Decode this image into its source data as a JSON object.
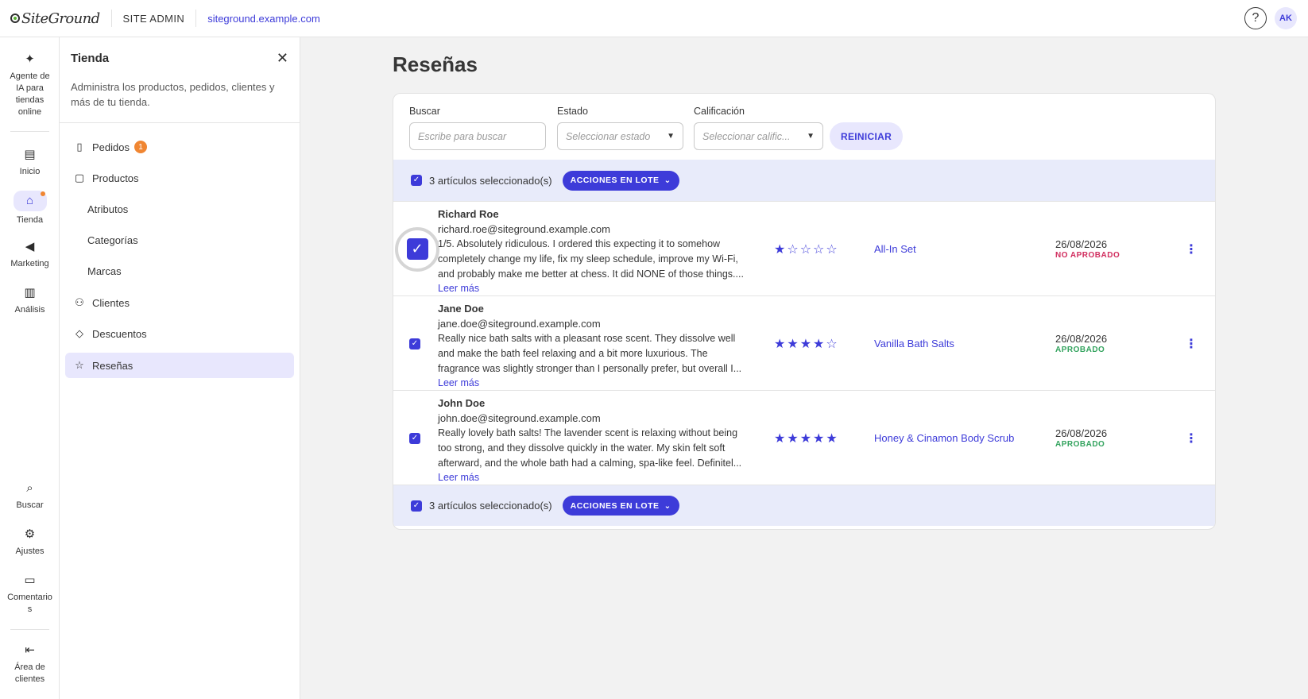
{
  "topbar": {
    "logo_text": "SiteGround",
    "section": "SITE ADMIN",
    "site_url": "siteground.example.com",
    "help_icon": "?",
    "avatar": "AK"
  },
  "rail": {
    "ai_agent": "Agente de IA para tiendas online",
    "home": "Inicio",
    "store": "Tienda",
    "marketing": "Marketing",
    "analytics": "Análisis",
    "search": "Buscar",
    "settings": "Ajustes",
    "feedback": "Comentarios",
    "client_area": "Área de clientes"
  },
  "panel": {
    "title": "Tienda",
    "description": "Administra los productos, pedidos, clientes y más de tu tienda.",
    "items": [
      {
        "label": "Pedidos",
        "badge": "1"
      },
      {
        "label": "Productos"
      },
      {
        "label": "Atributos"
      },
      {
        "label": "Categorías"
      },
      {
        "label": "Marcas"
      },
      {
        "label": "Clientes"
      },
      {
        "label": "Descuentos"
      },
      {
        "label": "Reseñas"
      }
    ]
  },
  "main": {
    "title": "Reseñas",
    "filters": {
      "search_label": "Buscar",
      "search_placeholder": "Escribe para buscar",
      "status_label": "Estado",
      "status_placeholder": "Seleccionar estado",
      "rating_label": "Calificación",
      "rating_placeholder": "Seleccionar calific...",
      "reset": "REINICIAR"
    },
    "bulk": {
      "selected_text": "3 artículos seleccionado(s)",
      "actions": "ACCIONES EN LOTE"
    },
    "reviews": [
      {
        "name": "Richard Roe",
        "email": "richard.roe@siteground.example.com",
        "text": "1/5. Absolutely ridiculous. I ordered this expecting it to somehow completely change my life, fix my sleep schedule, improve my Wi-Fi, and probably make me better at chess. It did NONE of those things....",
        "read_more": "Leer más",
        "rating": 1,
        "stars": "★☆☆☆☆",
        "product": "All-In Set",
        "date": "26/08/2026",
        "status": "NO APROBADO"
      },
      {
        "name": "Jane Doe",
        "email": "jane.doe@siteground.example.com",
        "text": "Really nice bath salts with a pleasant rose scent. They dissolve well and make the bath feel relaxing and a bit more luxurious. The fragrance was slightly stronger than I personally prefer, but overall I...",
        "read_more": "Leer más",
        "rating": 4,
        "stars": "★★★★☆",
        "product": "Vanilla Bath Salts",
        "date": "26/08/2026",
        "status": "APROBADO"
      },
      {
        "name": "John Doe",
        "email": "john.doe@siteground.example.com",
        "text": "Really lovely bath salts! The lavender scent is relaxing without being too strong, and they dissolve quickly in the water. My skin felt soft afterward, and the whole bath had a calming, spa-like feel. Definitel...",
        "read_more": "Leer más",
        "rating": 5,
        "stars": "★★★★★",
        "product": "Honey & Cinamon Body Scrub",
        "date": "26/08/2026",
        "status": "APROBADO"
      }
    ]
  },
  "colors": {
    "accent": "#3d3bd9",
    "accent_soft": "#e8e7fd",
    "notice": "#f08632",
    "status_bad": "#d12e5f",
    "status_good": "#33a35e"
  },
  "icons": {
    "sparkle": "sparkle-icon",
    "home": "dashboard-icon",
    "store": "store-icon",
    "marketing": "megaphone-icon",
    "analytics": "chart-icon",
    "search": "search-icon",
    "settings": "gear-icon",
    "feedback": "comment-icon",
    "client_area": "exit-icon"
  }
}
